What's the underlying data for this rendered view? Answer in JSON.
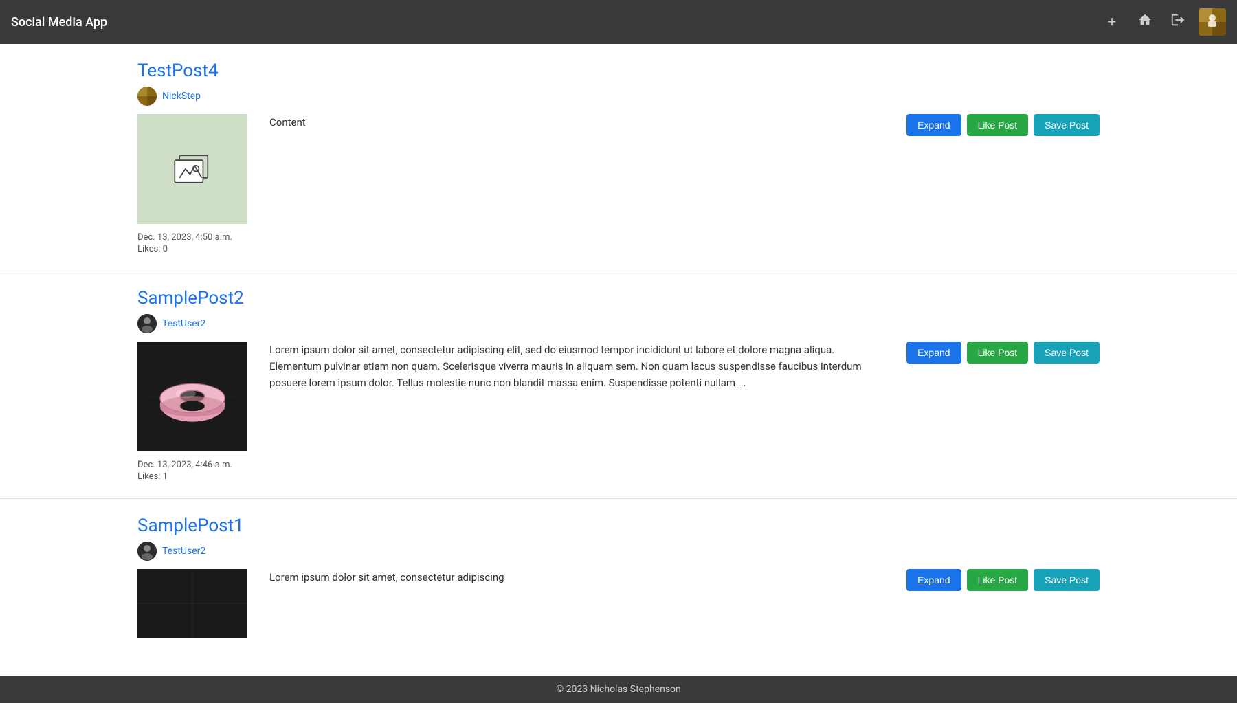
{
  "app": {
    "title": "Social Media App",
    "footer_copyright": "© 2023 Nicholas Stephenson"
  },
  "header": {
    "title": "Social Media App",
    "icons": {
      "add_label": "+",
      "home_label": "⌂",
      "logout_label": "→"
    }
  },
  "posts": [
    {
      "id": "post1",
      "title": "TestPost4",
      "author": "NickStep",
      "image_type": "placeholder",
      "content": "Content",
      "date": "Dec. 13, 2023, 4:50 a.m.",
      "likes": "Likes: 0",
      "btn_expand": "Expand",
      "btn_like": "Like Post",
      "btn_save": "Save Post"
    },
    {
      "id": "post2",
      "title": "SamplePost2",
      "author": "TestUser2",
      "image_type": "donut",
      "content": "Lorem ipsum dolor sit amet, consectetur adipiscing elit, sed do eiusmod tempor incididunt ut labore et dolore magna aliqua. Elementum pulvinar etiam non quam. Scelerisque viverra mauris in aliquam sem. Non quam lacus suspendisse faucibus interdum posuere lorem ipsum dolor. Tellus molestie nunc non blandit massa enim. Suspendisse potenti nullam ...",
      "date": "Dec. 13, 2023, 4:46 a.m.",
      "likes": "Likes: 1",
      "btn_expand": "Expand",
      "btn_like": "Like Post",
      "btn_save": "Save Post"
    },
    {
      "id": "post3",
      "title": "SamplePost1",
      "author": "TestUser2",
      "image_type": "partial",
      "content": "Lorem ipsum dolor sit amet, consectetur adipiscing",
      "date": "",
      "likes": "",
      "btn_expand": "Expand",
      "btn_like": "Like Post",
      "btn_save": "Save Post"
    }
  ]
}
